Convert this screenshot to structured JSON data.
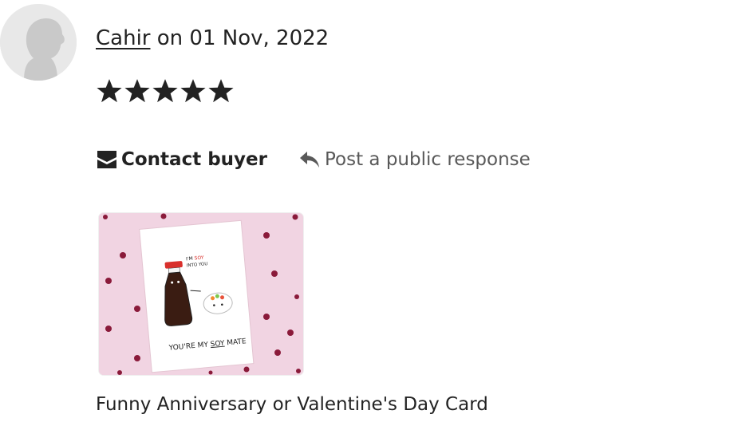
{
  "review": {
    "reviewer_name": "Cahir",
    "date_text": " on 01 Nov, 2022",
    "rating": 5,
    "rating_max": 5
  },
  "actions": {
    "contact_label": "Contact buyer",
    "respond_label": "Post a public response"
  },
  "product": {
    "card_text_top_1": "I'M ",
    "card_text_top_soy": "SOY",
    "card_text_top_2": "INTO YOU",
    "card_text_bottom_1": "YOU'RE MY ",
    "card_text_bottom_soy": "SOY",
    "card_text_bottom_2": " MATE",
    "caption": "Funny Anniversary or Valentine's Day Card"
  },
  "colors": {
    "text": "#222222",
    "muted": "#595959",
    "thumb_bg": "#f1d4e2",
    "heart": "#8a1a3a",
    "soy_red": "#d9302c"
  },
  "icons": [
    "avatar-placeholder",
    "star-icon",
    "envelope-icon",
    "reply-arrow-icon"
  ]
}
